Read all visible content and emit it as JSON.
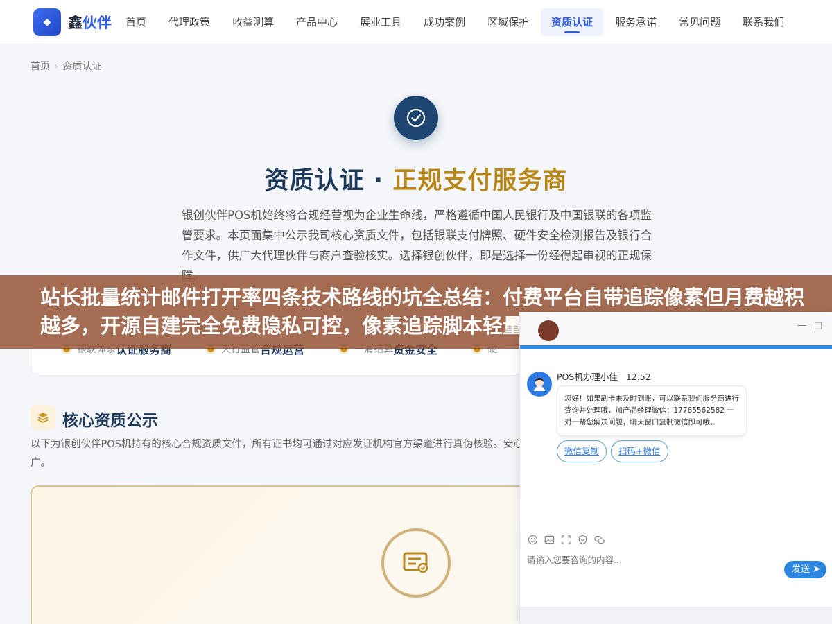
{
  "nav": {
    "logo_mark": "◆",
    "brand_a": "鑫",
    "brand_b": "伙伴",
    "items": [
      {
        "label": "首页"
      },
      {
        "label": "代理政策"
      },
      {
        "label": "收益测算"
      },
      {
        "label": "产品中心"
      },
      {
        "label": "展业工具"
      },
      {
        "label": "成功案例"
      },
      {
        "label": "区域保护"
      },
      {
        "label": "资质认证",
        "active": true
      },
      {
        "label": "服务承诺"
      },
      {
        "label": "常见问题"
      },
      {
        "label": "联系我们"
      }
    ]
  },
  "breadcrumb": {
    "home": "首页",
    "sep": "›",
    "current": "资质认证"
  },
  "hero": {
    "icon": "check-circle-icon",
    "title_a": "资质认证 · ",
    "title_b": "正规支付服务商",
    "desc": "银创伙伴POS机始终将合规经营视为企业生命线，严格遵循中国人民银行及中国银联的各项监管要求。本页面集中公示我司核心资质文件，包括银联支付牌照、硬件安全检测报告及银行合作文件，供广大代理伙伴与商户查验核实。选择银创伙伴，即是选择一份经得起审视的正规保障。"
  },
  "features": [
    {
      "small": "银联体系",
      "bold": "认证服务商"
    },
    {
      "small": "央行监管",
      "bold": "合规运营"
    },
    {
      "small": "一清结算",
      "bold": "资金安全"
    },
    {
      "small": "硬",
      "bold": ""
    }
  ],
  "section": {
    "icon": "layers-icon",
    "title": "核心资质公示",
    "desc": "以下为银创伙伴POS机持有的核心合规资质文件，所有证书均可通过对应发证机构官方渠道进行真伪核验。安心推广。"
  },
  "certificate": {
    "icon": "certificate-icon"
  },
  "banner": {
    "text": "站长批量统计邮件打开率四条技术路线的坑全总结：付费平台自带追踪像素但月费越积越多，开源自建完全免费隐私可控，像素追踪脚本轻量级能"
  },
  "chat": {
    "window_controls": [
      "—",
      "□"
    ],
    "agent_name": "POS机办理小佳",
    "time": "12:52",
    "message": "您好！如果刷卡未及时到账，可以联系我们服务商进行查询并处理哦，加产品经理微信：17765562582 一对一帮您解决问题，聊天窗口复制微信即可哦。",
    "buttons": [
      "微信复制",
      "扫码+微信"
    ],
    "tools": [
      "emoji-icon",
      "image-icon",
      "screenshot-icon",
      "rating-icon",
      "wechat-icon"
    ],
    "input_placeholder": "请输入您要咨询的内容...",
    "send_label": "发送",
    "send_arrow": "➤"
  },
  "colors": {
    "primary": "#2d5be3",
    "navy": "#1e3a5a",
    "gold": "#b8871a",
    "banner": "#965537",
    "chat_blue": "#2d86e0"
  }
}
